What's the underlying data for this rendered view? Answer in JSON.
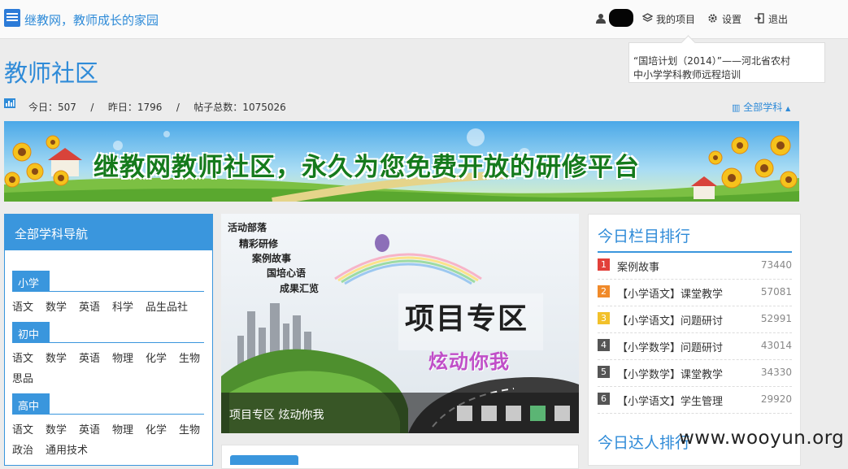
{
  "header": {
    "site_title": "继教网，教师成长的家园",
    "nav_projects": "我的项目",
    "nav_settings": "设置",
    "nav_logout": "退出",
    "project_popup": [
      "“国培计划（2014）”——河北省农村",
      "中小学学科教师远程培训"
    ]
  },
  "page": {
    "title": "教师社区",
    "stats": "今日：507   /   昨日：1796   /   帖子总数：1075026",
    "all_subjects": "全部学科"
  },
  "banner": {
    "text": "继教网教师社区，永久为您免费开放的研修平台"
  },
  "left_nav": {
    "title": "全部学科导航",
    "sections": [
      {
        "name": "小学",
        "items": [
          "语文",
          "数学",
          "英语",
          "科学",
          "品生品社"
        ]
      },
      {
        "name": "初中",
        "items": [
          "语文",
          "数学",
          "英语",
          "物理",
          "化学",
          "生物",
          "思品"
        ]
      },
      {
        "name": "高中",
        "items": [
          "语文",
          "数学",
          "英语",
          "物理",
          "化学",
          "生物",
          "政治",
          "通用技术"
        ]
      }
    ]
  },
  "carousel": {
    "image_texts": [
      "活动部落",
      "精彩研修",
      "案例故事",
      "国培心语",
      "成果汇览",
      "项目专区",
      "炫动你我"
    ],
    "caption": "项目专区 炫动你我",
    "dot_count": 5,
    "active_dot": 4
  },
  "right_panel": {
    "title": "今日栏目排行",
    "rankings": [
      {
        "rank": "1",
        "name": "案例故事",
        "count": "73440",
        "color": "#e2403a"
      },
      {
        "rank": "2",
        "name": "【小学语文】课堂教学",
        "count": "57081",
        "color": "#f08a2a"
      },
      {
        "rank": "3",
        "name": "【小学语文】问题研讨",
        "count": "52991",
        "color": "#f2c12b"
      },
      {
        "rank": "4",
        "name": "【小学数学】问题研讨",
        "count": "43014",
        "color": "#555555"
      },
      {
        "rank": "5",
        "name": "【小学数学】课堂教学",
        "count": "34330",
        "color": "#555555"
      },
      {
        "rank": "6",
        "name": "【小学语文】学生管理",
        "count": "29920",
        "color": "#555555"
      }
    ],
    "title2": "今日达人排行"
  },
  "watermark": "www.wooyun.org",
  "colors": {
    "accent": "#3a96dd",
    "title_blue": "#2f8bd8",
    "active_dot": "#5bb574"
  }
}
